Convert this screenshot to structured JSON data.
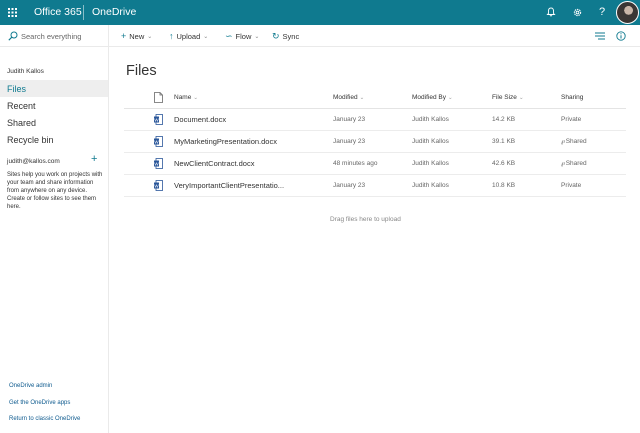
{
  "topbar": {
    "brand": "Office 365",
    "app_name": "OneDrive",
    "icons": [
      "waffle-icon",
      "bell-icon",
      "gear-icon",
      "help-icon",
      "avatar"
    ],
    "accent": "#0f7a8f"
  },
  "search": {
    "placeholder": "Search everything"
  },
  "commands": {
    "new_label": "New",
    "upload_label": "Upload",
    "flow_label": "Flow",
    "sync_label": "Sync"
  },
  "nav": {
    "user_name": "Judith Kallos",
    "items": [
      {
        "label": "Files",
        "active": true
      },
      {
        "label": "Recent"
      },
      {
        "label": "Shared"
      },
      {
        "label": "Recycle bin"
      }
    ],
    "site_email": "judith@kallos.com",
    "site_description": "Sites help you work on projects with your team and share information from anywhere on any device. Create or follow sites to see them here.",
    "footer_links": [
      "OneDrive admin",
      "Get the OneDrive apps",
      "Return to classic OneDrive"
    ]
  },
  "main": {
    "title": "Files",
    "columns": {
      "name": "Name",
      "modified": "Modified",
      "modified_by": "Modified By",
      "file_size": "File Size",
      "sharing": "Sharing"
    },
    "rows": [
      {
        "name": "Document.docx",
        "modified": "January 23",
        "modified_by": "Judith Kallos",
        "size": "14.2 KB",
        "sharing": "Private"
      },
      {
        "name": "MyMarketingPresentation.docx",
        "modified": "January 23",
        "modified_by": "Judith Kallos",
        "size": "39.1 KB",
        "sharing": "Shared"
      },
      {
        "name": "NewClientContract.docx",
        "modified": "48 minutes ago",
        "modified_by": "Judith Kallos",
        "size": "42.6 KB",
        "sharing": "Shared"
      },
      {
        "name": "VeryImportantClientPresentatio...",
        "modified": "January 23",
        "modified_by": "Judith Kallos",
        "size": "10.8 KB",
        "sharing": "Private"
      }
    ],
    "drag_hint": "Drag files here to upload"
  }
}
